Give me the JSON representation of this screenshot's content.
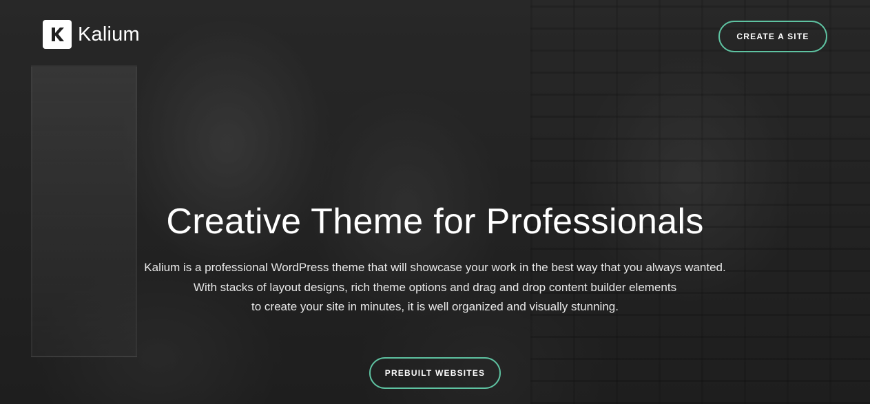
{
  "header": {
    "logo_text": "Kalium",
    "logo_icon": "kalium-k-icon",
    "cta_label": "CREATE A SITE"
  },
  "hero": {
    "title": "Creative Theme for Professionals",
    "description_lines": [
      "Kalium is a professional WordPress theme that will showcase your work in the best way that you always wanted.",
      "With stacks of layout designs, rich theme options and drag and drop content builder elements",
      "to create your site in minutes, it is well organized and visually stunning."
    ],
    "button_label": "PREBUILT WEBSITES"
  },
  "colors": {
    "accent": "#5ec2a1",
    "background": "#2a2a2a",
    "text": "#ffffff"
  }
}
